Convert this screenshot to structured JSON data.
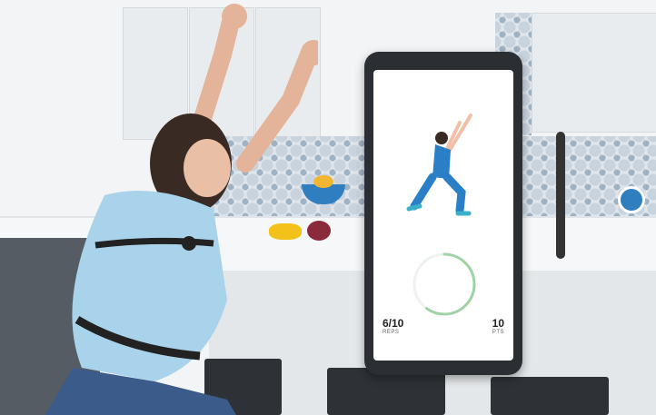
{
  "screen": {
    "reps_value": "6/10",
    "reps_label": "REPS",
    "points_value": "10",
    "points_label": "PTS",
    "progress_fraction": 0.6,
    "progress_color": "#9fd3a6"
  },
  "colors": {
    "shirt": "#a9d3ea",
    "jeans": "#3b5b8a",
    "strap": "#222222",
    "hair": "#3a2a24"
  }
}
